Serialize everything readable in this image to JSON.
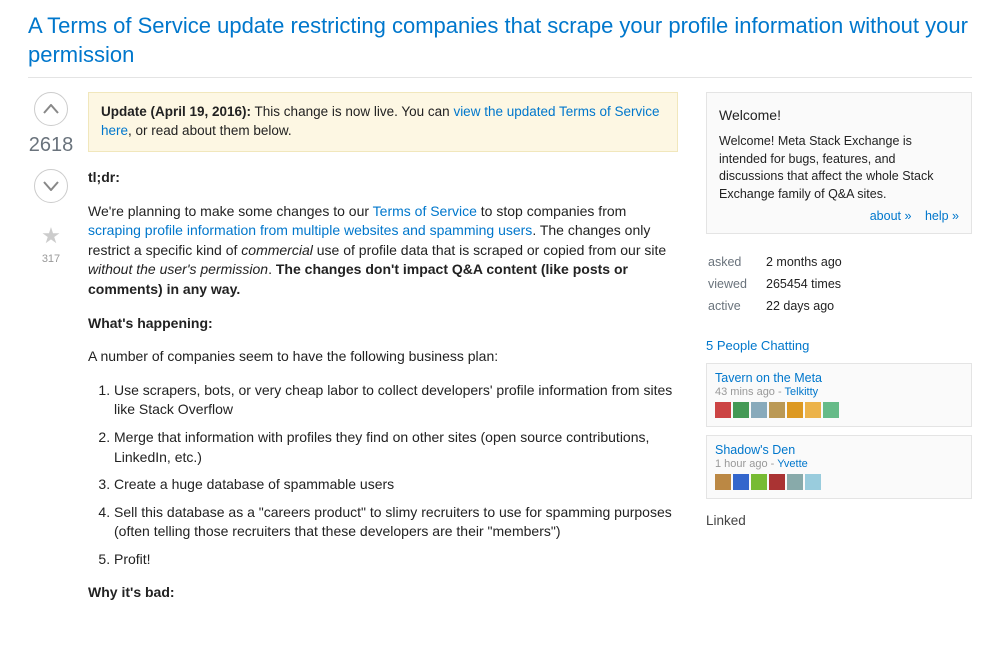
{
  "title": "A Terms of Service update restricting companies that scrape your profile information without your permission",
  "vote": {
    "score": "2618",
    "favorites": "317"
  },
  "notice": {
    "prefix": "Update (April 19, 2016):",
    "text_before_link": " This change is now live. You can ",
    "link": "view the updated Terms of Service here",
    "text_after_link": ", or read about them below."
  },
  "post": {
    "tldr": "tl;dr:",
    "p1_a": "We're planning to make some changes to our ",
    "p1_link1": "Terms of Service",
    "p1_b": " to stop companies from ",
    "p1_link2": "scraping profile information from multiple websites and spamming users",
    "p1_c": ". The changes only restrict a specific kind of ",
    "p1_em": "commercial",
    "p1_d": " use of profile data that is scraped or copied from our site ",
    "p1_em2": "without the user's permission",
    "p1_e": ". ",
    "p1_strong": "The changes don't impact Q&A content (like posts or comments) in any way.",
    "h1": "What's happening:",
    "p2": "A number of companies seem to have the following business plan:",
    "list": [
      "Use scrapers, bots, or very cheap labor to collect developers' profile information from sites like Stack Overflow",
      "Merge that information with profiles they find on other sites (open source contributions, LinkedIn, etc.)",
      "Create a huge database of spammable users",
      "Sell this database as a \"careers product\" to slimy recruiters to use for spamming purposes (often telling those recruiters that these developers are their \"members\")",
      "Profit!"
    ],
    "h2": "Why it's bad:"
  },
  "sidebar": {
    "welcome_title": "Welcome!",
    "welcome_text": "Welcome! Meta Stack Exchange is intended for bugs, features, and discussions that affect the whole Stack Exchange family of Q&A sites.",
    "about": "about »",
    "help": "help »",
    "asked_label": "asked",
    "asked_val": "2 months ago",
    "viewed_label": "viewed",
    "viewed_val": "265454 times",
    "active_label": "active",
    "active_val": "22 days ago",
    "chat_heading": "5 People Chatting",
    "rooms": [
      {
        "name": "Tavern on the Meta",
        "when": "43 mins ago",
        "sep": " - ",
        "who": "Telkitty",
        "avatars": [
          "#c44",
          "#495",
          "#8ab",
          "#b95",
          "#d92",
          "#ecb34a",
          "#6b8"
        ]
      },
      {
        "name": "Shadow's Den",
        "when": "1 hour ago",
        "sep": " - ",
        "who": "Yvette",
        "avatars": [
          "#b84",
          "#36c",
          "#7b3",
          "#a33",
          "#8aa",
          "#9cd"
        ]
      }
    ],
    "linked": "Linked"
  }
}
